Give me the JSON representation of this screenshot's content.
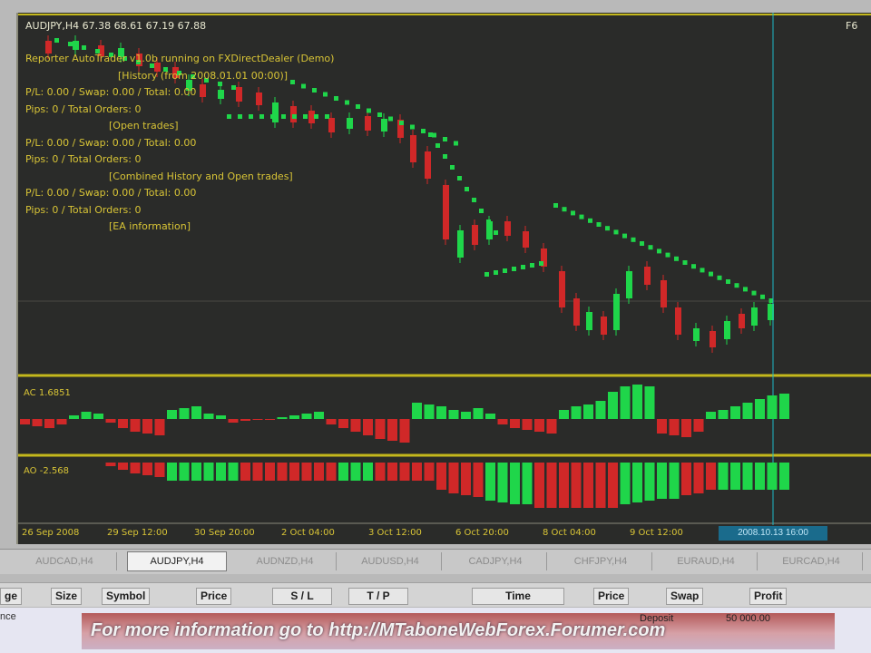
{
  "chart": {
    "symbol_line": "AUDJPY,H4  67.38 68.61 67.19 67.88",
    "right_label": "F6",
    "overlay_lines": [
      "Reporter AutoTrader v1.0b running on FXDirectDealer (Demo)",
      "[History (from 2008.01.01 00:00)]",
      "P/L: 0.00 / Swap: 0.00 / Total: 0.00",
      "Pips: 0 / Total Orders: 0",
      "[Open trades]",
      "P/L: 0.00 / Swap: 0.00 / Total: 0.00",
      "Pips: 0 / Total Orders: 0",
      "[Combined History and Open trades]",
      "P/L: 0.00 / Swap: 0.00 / Total: 0.00",
      "Pips: 0 / Total Orders: 0",
      "[EA information]"
    ],
    "ac_label": "AC 1.6851",
    "ao_label": "AO -2.568",
    "x_ticks": [
      "26 Sep 2008",
      "29 Sep 12:00",
      "30 Sep 20:00",
      "2 Oct 04:00",
      "3 Oct 12:00",
      "6 Oct 20:00",
      "8 Oct 04:00",
      "9 Oct 12:00"
    ],
    "x_highlight": "2008.10.13 16:00",
    "colors": {
      "bull": "#1fd64a",
      "bear": "#d02828",
      "background": "#2a2b29",
      "separator": "#c4b81c",
      "cursor": "#1fb8c8"
    }
  },
  "tabs": [
    "AUDCAD,H4",
    "AUDJPY,H4",
    "AUDNZD,H4",
    "AUDUSD,H4",
    "CADJPY,H4",
    "CHFJPY,H4",
    "EURAUD,H4",
    "EURCAD,H4"
  ],
  "active_tab": "AUDJPY,H4",
  "terminal": {
    "columns": [
      "ge",
      "Size",
      "Symbol",
      "Price",
      "S / L",
      "T / P",
      "Time",
      "Price",
      "Swap",
      "Profit"
    ],
    "row_left": "nce",
    "deposit_label": "Deposit",
    "deposit_value": "50 000.00"
  },
  "banner": "For more information go to http://MTaboneWebForex.Forumer.com"
}
